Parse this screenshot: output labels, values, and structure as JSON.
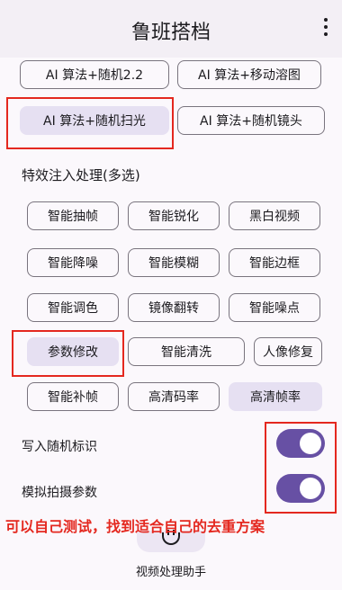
{
  "app": {
    "title": "鲁班搭档"
  },
  "algorithms": [
    {
      "label": "AI 算法+随机2.2",
      "selected": false
    },
    {
      "label": "AI 算法+移动溶图",
      "selected": false
    },
    {
      "label": "AI 算法+随机扫光",
      "selected": true
    },
    {
      "label": "AI 算法+随机镜头",
      "selected": false
    }
  ],
  "effects": {
    "title": "特效注入处理(多选)",
    "items": [
      {
        "label": "智能抽帧",
        "selected": false
      },
      {
        "label": "智能锐化",
        "selected": false
      },
      {
        "label": "黑白视频",
        "selected": false
      },
      {
        "label": "智能降噪",
        "selected": false
      },
      {
        "label": "智能模糊",
        "selected": false
      },
      {
        "label": "智能边框",
        "selected": false
      },
      {
        "label": "智能调色",
        "selected": false
      },
      {
        "label": "镜像翻转",
        "selected": false
      },
      {
        "label": "智能噪点",
        "selected": false
      },
      {
        "label": "参数修改",
        "selected": true
      },
      {
        "label": "智能清洗",
        "selected": false
      },
      {
        "label": "人像修复",
        "selected": false
      },
      {
        "label": "智能补帧",
        "selected": false
      },
      {
        "label": "高清码率",
        "selected": false
      },
      {
        "label": "高清帧率",
        "selected": true
      }
    ]
  },
  "toggles": [
    {
      "label": "写入随机标识",
      "on": true
    },
    {
      "label": "模拟拍摄参数",
      "on": true
    }
  ],
  "annotation": {
    "text": "可以自己测试，找到适合自己的去重方案"
  },
  "bottom": {
    "label": "视频处理助手"
  },
  "colors": {
    "accent": "#6750a4",
    "chip_selected": "#e6e0f2",
    "highlight": "#e4281f"
  }
}
